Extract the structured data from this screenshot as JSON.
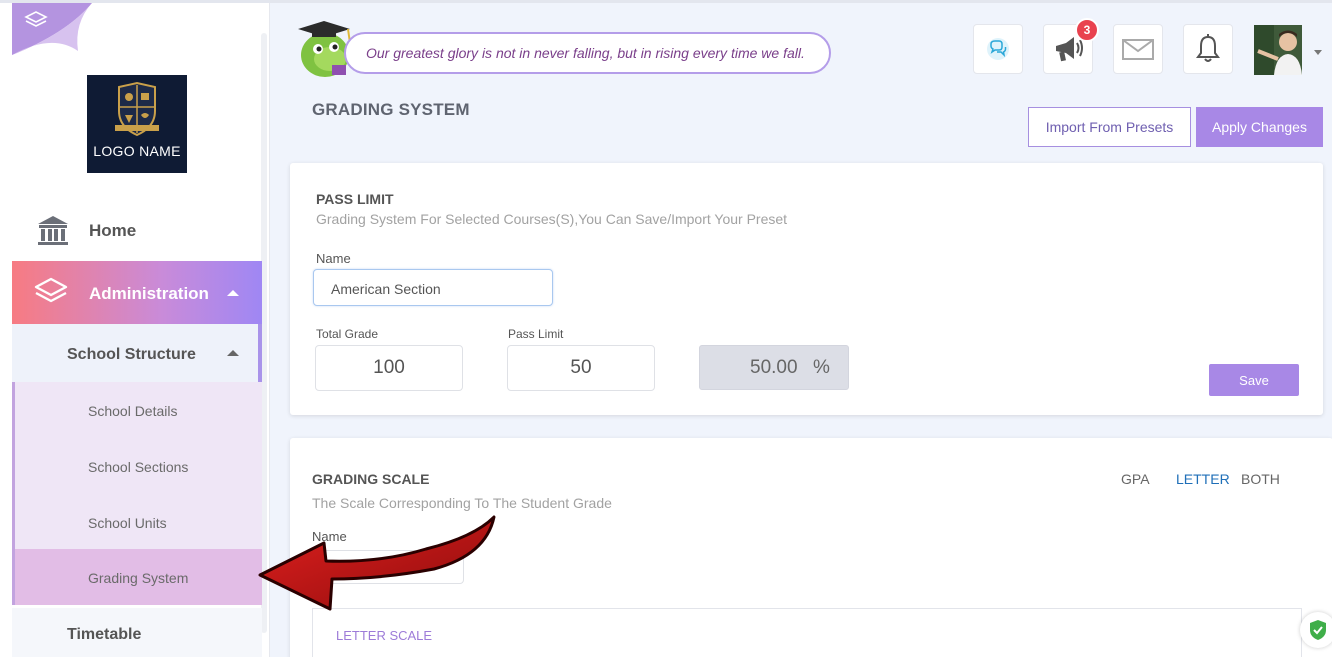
{
  "sidebar": {
    "logo_text": "LOGO NAME",
    "home_label": "Home",
    "admin_label": "Administration",
    "structure_label": "School Structure",
    "sub_items": [
      "School Details",
      "School Sections",
      "School Units",
      "Grading System"
    ],
    "timetable_label": "Timetable"
  },
  "header": {
    "quote": "Our greatest glory is not in never falling, but in rising every time we fall.",
    "announcement_count": "3"
  },
  "page": {
    "title": "GRADING SYSTEM",
    "import_label": "Import From Presets",
    "apply_label": "Apply Changes"
  },
  "pass_limit": {
    "title": "PASS LIMIT",
    "subtitle": "Grading System For Selected Courses(S),You Can Save/Import Your Preset",
    "name_label": "Name",
    "name_value": "American Section",
    "total_label": "Total Grade",
    "total_value": "100",
    "pass_label": "Pass Limit",
    "pass_value": "50",
    "percent_value": "50.00",
    "percent_unit": "%",
    "save_label": "Save"
  },
  "grading_scale": {
    "title": "GRADING SCALE",
    "subtitle": "The Scale Corresponding To The Student Grade",
    "tabs": [
      "GPA",
      "LETTER",
      "BOTH"
    ],
    "active_tab": "LETTER",
    "name_label": "Name",
    "letter_scale_label": "LETTER SCALE"
  },
  "colors": {
    "accent": "#a888e6",
    "admin_gradient_start": "#f77b82",
    "admin_gradient_end": "#9f87f4",
    "badge": "#e9424f",
    "active_tab": "#1f6fb8"
  }
}
